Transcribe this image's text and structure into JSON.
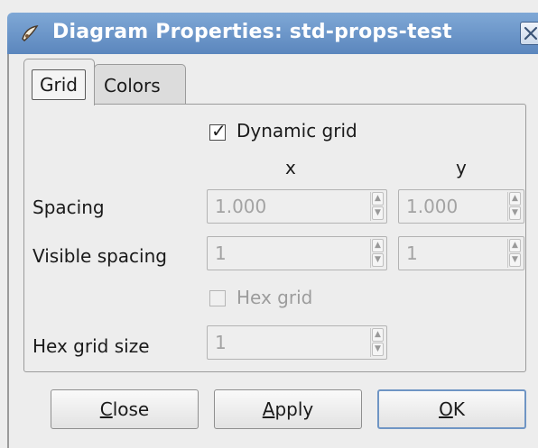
{
  "window": {
    "title": "Diagram Properties: std-props-test",
    "accent_color": "#5b86bd"
  },
  "tabs": [
    {
      "label": "Grid",
      "selected": true
    },
    {
      "label": "Colors",
      "selected": false
    }
  ],
  "grid": {
    "dynamic_grid": {
      "label": "Dynamic grid",
      "checked": true
    },
    "col_x": "x",
    "col_y": "y",
    "spacing": {
      "label": "Spacing",
      "x": "1.000",
      "y": "1.000"
    },
    "visible_spacing": {
      "label": "Visible spacing",
      "x": "1",
      "y": "1"
    },
    "hex_grid": {
      "label": "Hex grid",
      "checked": false
    },
    "hex_grid_size": {
      "label": "Hex grid size",
      "value": "1"
    }
  },
  "buttons": {
    "close": {
      "first": "C",
      "rest": "lose"
    },
    "apply": {
      "first": "A",
      "rest": "pply"
    },
    "ok": {
      "first": "O",
      "rest": "K"
    }
  },
  "icons": {
    "app": "dia-app-icon",
    "close": "close-icon",
    "check": "checkmark-icon",
    "spin_up": "chevron-up-icon",
    "spin_down": "chevron-down-icon"
  }
}
